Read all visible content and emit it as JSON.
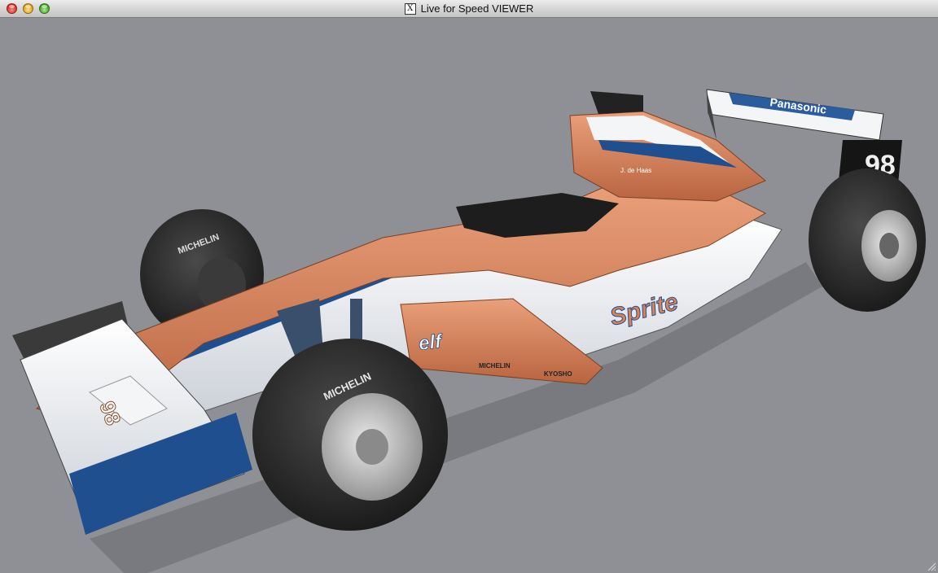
{
  "window": {
    "title": "Live for Speed VIEWER",
    "title_icon_glyph": "X",
    "buttons": [
      "close-button",
      "minimize-button",
      "zoom-button"
    ]
  },
  "car": {
    "number": "98",
    "driver": "J. de Haas",
    "wing_sponsor": "Panasonic",
    "sidepod_sponsor": "elf",
    "tyre_brand": "MICHELIN",
    "sidepod_small": [
      "MICHELIN",
      "KYOSHO"
    ],
    "side_script": "Sprite",
    "colors": {
      "orange": "#d9825a",
      "white": "#f2f4f6",
      "blue": "#1f4f8f",
      "tyre": "#2b2b2b",
      "background": "#8e9095"
    }
  }
}
